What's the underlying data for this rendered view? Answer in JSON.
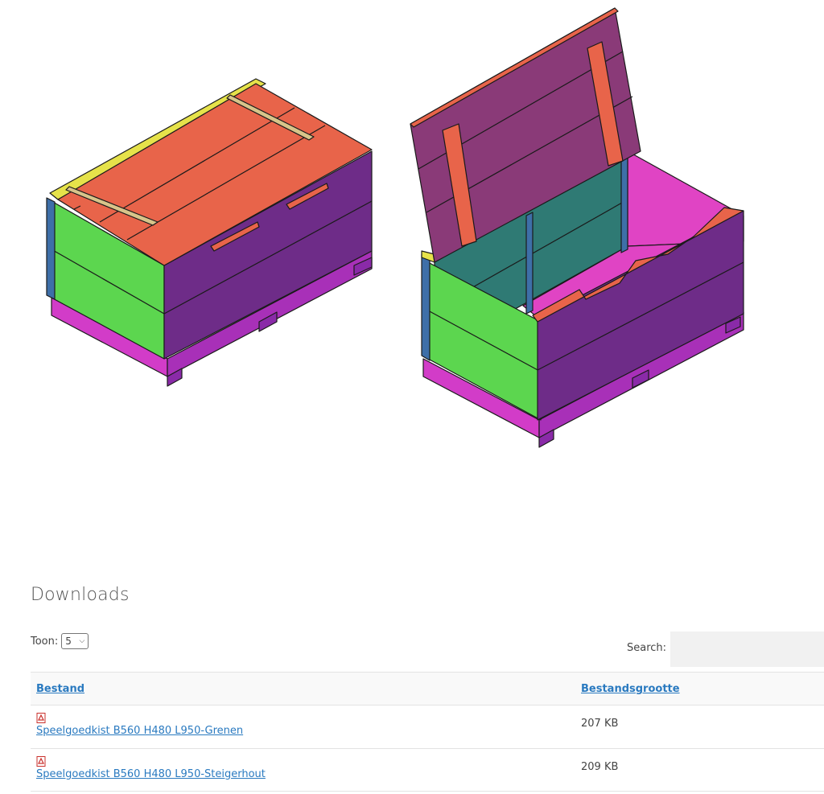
{
  "illustration": {
    "description_icon": "storage-chest-drawing",
    "colors": {
      "lid": "#e8644a",
      "lid_open": "#8a3a78",
      "side_green": "#5cd64f",
      "front_purple": "#6e2c88",
      "interior": "#e044c4",
      "back_teal": "#2f7a74",
      "base_magenta": "#d23cc8",
      "yellow": "#e6e24a",
      "blue": "#3e6fa8"
    }
  },
  "downloads": {
    "title": "Downloads",
    "toon_label": "Toon:",
    "toon_value": "5",
    "search_label": "Search:",
    "search_value": "",
    "columns": [
      "Bestand",
      "Bestandsgrootte"
    ],
    "rows": [
      {
        "icon": "pdf-icon",
        "name": "Speelgoedkist B560 H480 L950-Grenen",
        "size": "207 KB"
      },
      {
        "icon": "pdf-icon",
        "name": "Speelgoedkist B560 H480 L950-Steigerhout",
        "size": "209 KB"
      }
    ]
  }
}
